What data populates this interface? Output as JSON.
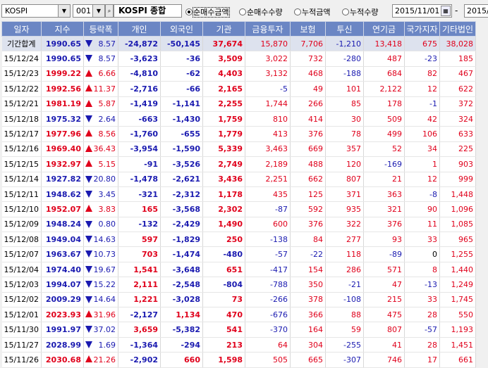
{
  "toolbar": {
    "market_select": "KOSPI",
    "code_select": "001",
    "index_title": "KOSPI 종합",
    "radios": [
      {
        "label": "순매수금액",
        "checked": true
      },
      {
        "label": "순매수수량",
        "checked": false
      },
      {
        "label": "누적금액",
        "checked": false
      },
      {
        "label": "누적수량",
        "checked": false
      }
    ],
    "date_from": "2015/11/01",
    "date_sep": "-",
    "date_to": "2015/"
  },
  "colors": {
    "header_bg": "#6b86c4",
    "up": "#e0001b",
    "down": "#1a1ab0",
    "sum_row_bg": "#dde2ee"
  },
  "table": {
    "columns": [
      "일자",
      "지수",
      "등락폭",
      "개인",
      "외국인",
      "기관",
      "금융투자",
      "보험",
      "투신",
      "연기금",
      "국가지자",
      "기타법인"
    ],
    "rows": [
      {
        "date": "기간합계",
        "index": "1990.65",
        "dir": "dn",
        "chg": "8.57",
        "vals": [
          "-24,872",
          "-50,145",
          "37,674",
          "15,870",
          "7,706",
          "-1,210",
          "13,418",
          "675",
          "38,028"
        ]
      },
      {
        "date": "15/12/24",
        "index": "1990.65",
        "dir": "dn",
        "chg": "8.57",
        "vals": [
          "-3,623",
          "-36",
          "3,509",
          "3,022",
          "732",
          "-280",
          "487",
          "-23",
          "185"
        ]
      },
      {
        "date": "15/12/23",
        "index": "1999.22",
        "dir": "up",
        "chg": "6.66",
        "vals": [
          "-4,810",
          "-62",
          "4,403",
          "3,132",
          "468",
          "-188",
          "684",
          "82",
          "467"
        ]
      },
      {
        "date": "15/12/22",
        "index": "1992.56",
        "dir": "up",
        "chg": "11.37",
        "vals": [
          "-2,716",
          "-66",
          "2,165",
          "-5",
          "49",
          "101",
          "2,122",
          "12",
          "622"
        ]
      },
      {
        "date": "15/12/21",
        "index": "1981.19",
        "dir": "up",
        "chg": "5.87",
        "vals": [
          "-1,419",
          "-1,141",
          "2,255",
          "1,744",
          "266",
          "85",
          "178",
          "-1",
          "372"
        ]
      },
      {
        "date": "15/12/18",
        "index": "1975.32",
        "dir": "dn",
        "chg": "2.64",
        "vals": [
          "-663",
          "-1,430",
          "1,759",
          "810",
          "414",
          "30",
          "509",
          "42",
          "324"
        ]
      },
      {
        "date": "15/12/17",
        "index": "1977.96",
        "dir": "up",
        "chg": "8.56",
        "vals": [
          "-1,760",
          "-655",
          "1,779",
          "413",
          "376",
          "78",
          "499",
          "106",
          "633"
        ]
      },
      {
        "date": "15/12/16",
        "index": "1969.40",
        "dir": "up",
        "chg": "36.43",
        "vals": [
          "-3,954",
          "-1,590",
          "5,339",
          "3,463",
          "669",
          "357",
          "52",
          "34",
          "225"
        ]
      },
      {
        "date": "15/12/15",
        "index": "1932.97",
        "dir": "up",
        "chg": "5.15",
        "vals": [
          "-91",
          "-3,526",
          "2,749",
          "2,189",
          "488",
          "120",
          "-169",
          "1",
          "903"
        ]
      },
      {
        "date": "15/12/14",
        "index": "1927.82",
        "dir": "dn",
        "chg": "20.80",
        "vals": [
          "-1,478",
          "-2,621",
          "3,436",
          "2,251",
          "662",
          "807",
          "21",
          "12",
          "999"
        ]
      },
      {
        "date": "15/12/11",
        "index": "1948.62",
        "dir": "dn",
        "chg": "3.45",
        "vals": [
          "-321",
          "-2,312",
          "1,178",
          "435",
          "125",
          "371",
          "363",
          "-8",
          "1,448"
        ]
      },
      {
        "date": "15/12/10",
        "index": "1952.07",
        "dir": "up",
        "chg": "3.83",
        "vals": [
          "165",
          "-3,568",
          "2,302",
          "-87",
          "592",
          "935",
          "321",
          "90",
          "1,096"
        ]
      },
      {
        "date": "15/12/09",
        "index": "1948.24",
        "dir": "dn",
        "chg": "0.80",
        "vals": [
          "-132",
          "-2,429",
          "1,490",
          "600",
          "376",
          "322",
          "376",
          "11",
          "1,085"
        ]
      },
      {
        "date": "15/12/08",
        "index": "1949.04",
        "dir": "dn",
        "chg": "14.63",
        "vals": [
          "597",
          "-1,829",
          "250",
          "-138",
          "84",
          "277",
          "93",
          "33",
          "965"
        ]
      },
      {
        "date": "15/12/07",
        "index": "1963.67",
        "dir": "dn",
        "chg": "10.73",
        "vals": [
          "703",
          "-1,474",
          "-480",
          "-57",
          "-22",
          "118",
          "-89",
          "0",
          "1,255"
        ]
      },
      {
        "date": "15/12/04",
        "index": "1974.40",
        "dir": "dn",
        "chg": "19.67",
        "vals": [
          "1,541",
          "-3,648",
          "651",
          "-417",
          "154",
          "286",
          "571",
          "8",
          "1,440"
        ]
      },
      {
        "date": "15/12/03",
        "index": "1994.07",
        "dir": "dn",
        "chg": "15.22",
        "vals": [
          "2,111",
          "-2,548",
          "-804",
          "-788",
          "350",
          "-21",
          "47",
          "-13",
          "1,249"
        ]
      },
      {
        "date": "15/12/02",
        "index": "2009.29",
        "dir": "dn",
        "chg": "14.64",
        "vals": [
          "1,221",
          "-3,028",
          "73",
          "-266",
          "378",
          "-108",
          "215",
          "33",
          "1,745"
        ]
      },
      {
        "date": "15/12/01",
        "index": "2023.93",
        "dir": "up",
        "chg": "31.96",
        "vals": [
          "-2,127",
          "1,134",
          "470",
          "-676",
          "366",
          "88",
          "475",
          "28",
          "550"
        ]
      },
      {
        "date": "15/11/30",
        "index": "1991.97",
        "dir": "dn",
        "chg": "37.02",
        "vals": [
          "3,659",
          "-5,382",
          "541",
          "-370",
          "164",
          "59",
          "807",
          "-57",
          "1,193"
        ]
      },
      {
        "date": "15/11/27",
        "index": "2028.99",
        "dir": "dn",
        "chg": "1.69",
        "vals": [
          "-1,364",
          "-294",
          "213",
          "64",
          "304",
          "-255",
          "41",
          "28",
          "1,451"
        ]
      },
      {
        "date": "15/11/26",
        "index": "2030.68",
        "dir": "up",
        "chg": "21.26",
        "vals": [
          "-2,902",
          "660",
          "1,598",
          "505",
          "665",
          "-307",
          "746",
          "17",
          "661"
        ]
      }
    ]
  }
}
